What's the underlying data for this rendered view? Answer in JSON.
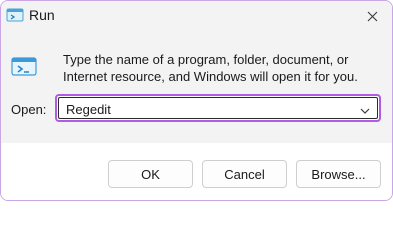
{
  "window": {
    "title": "Run",
    "title_icon": "run-app-icon",
    "close_icon": "close-icon",
    "accent_color": "#b05ae6"
  },
  "dialog": {
    "description": "Type the name of a program, folder, document, or Internet resource, and Windows will open it for you.",
    "open_label": "Open:",
    "open_value": "Regedit",
    "dropdown_icon": "chevron-down-icon"
  },
  "buttons": {
    "ok": "OK",
    "cancel": "Cancel",
    "browse": "Browse..."
  }
}
